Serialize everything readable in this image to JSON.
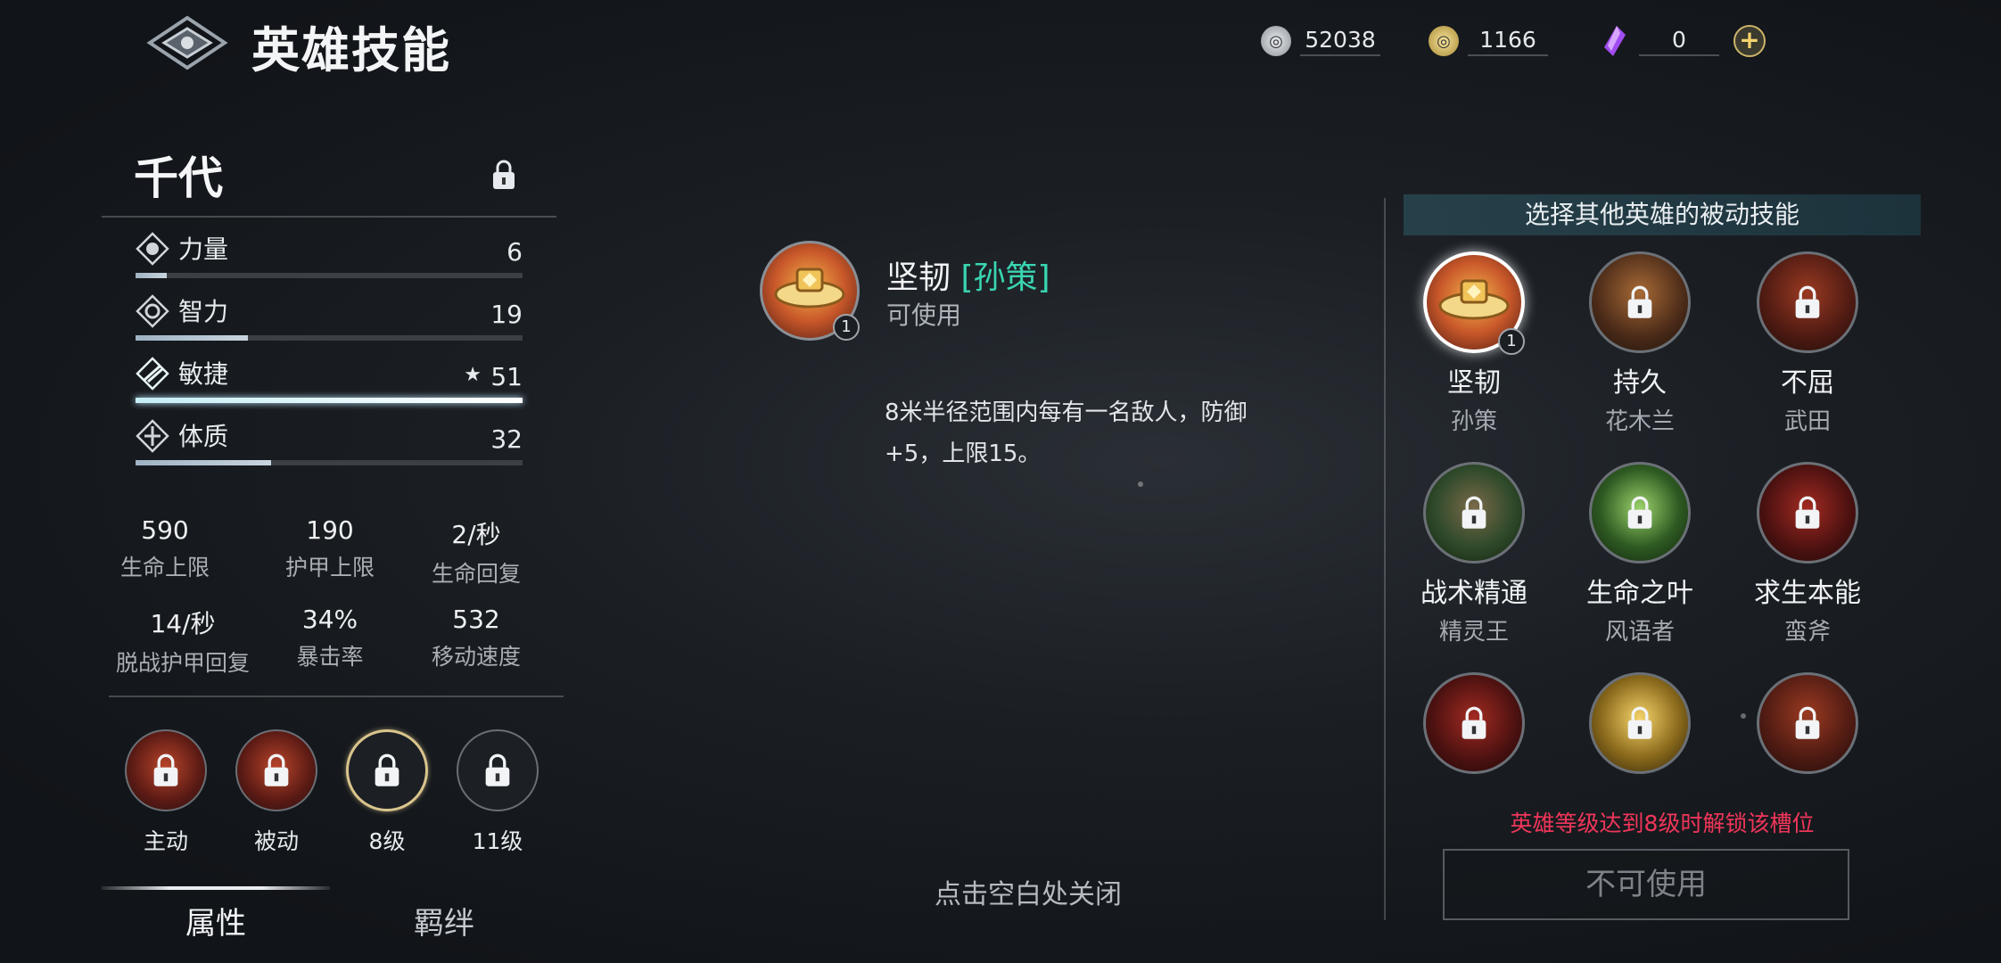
{
  "header": {
    "title": "英雄技能",
    "currencies": [
      {
        "icon": "silver-coin-icon",
        "value": "52038"
      },
      {
        "icon": "gold-coin-icon",
        "value": "1166"
      },
      {
        "icon": "purple-crystal-icon",
        "value": "0"
      }
    ],
    "add_icon": "plus-icon"
  },
  "hero": {
    "name": "千代",
    "attributes": [
      {
        "label": "力量",
        "value": "6",
        "fill": 0.08
      },
      {
        "label": "智力",
        "value": "19",
        "fill": 0.29
      },
      {
        "label": "敏捷",
        "value": "51",
        "fill": 1.0,
        "starred": true
      },
      {
        "label": "体质",
        "value": "32",
        "fill": 0.35
      }
    ],
    "stats": [
      {
        "value": "590",
        "label": "生命上限"
      },
      {
        "value": "190",
        "label": "护甲上限"
      },
      {
        "value": "2/秒",
        "label": "生命回复"
      },
      {
        "value": "14/秒",
        "label": "脱战护甲回复"
      },
      {
        "value": "34%",
        "label": "暴击率"
      },
      {
        "value": "532",
        "label": "移动速度"
      }
    ],
    "skill_slots": [
      {
        "label": "主动"
      },
      {
        "label": "被动"
      },
      {
        "label": "8级"
      },
      {
        "label": "11级"
      }
    ],
    "tabs": [
      {
        "label": "属性",
        "active": true
      },
      {
        "label": "羁绊",
        "active": false
      }
    ]
  },
  "detail": {
    "name": "坚韧",
    "source": "[孙策]",
    "status": "可使用",
    "level_badge": "1",
    "description": "8米半径范围内每有一名敌人，防御+5，上限15。",
    "close_hint": "点击空白处关闭"
  },
  "passive_panel": {
    "title": "选择其他英雄的被动技能",
    "skills": [
      {
        "name": "坚韧",
        "hero": "孙策",
        "badge": "1",
        "selected": true,
        "locked": false
      },
      {
        "name": "持久",
        "hero": "花木兰",
        "locked": true
      },
      {
        "name": "不屈",
        "hero": "武田",
        "locked": true
      },
      {
        "name": "战术精通",
        "hero": "精灵王",
        "locked": true
      },
      {
        "name": "生命之叶",
        "hero": "风语者",
        "locked": true
      },
      {
        "name": "求生本能",
        "hero": "蛮斧",
        "locked": true
      },
      {
        "locked": true
      },
      {
        "locked": true
      },
      {
        "locked": true
      }
    ],
    "unlock_note": "英雄等级达到8级时解锁该槽位",
    "action_button": "不可使用"
  },
  "colors": {
    "accent_teal": "#39d5b1",
    "warning_red": "#f0365a",
    "gold": "#f4d36d"
  }
}
